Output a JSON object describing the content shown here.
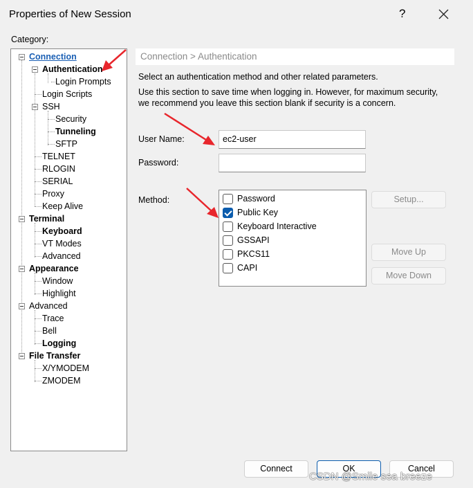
{
  "window": {
    "title": "Properties of New Session",
    "help_label": "?"
  },
  "category_label": "Category:",
  "tree": {
    "connection": "Connection",
    "authentication": "Authentication",
    "login_prompts": "Login Prompts",
    "login_scripts": "Login Scripts",
    "ssh": "SSH",
    "security": "Security",
    "tunneling": "Tunneling",
    "sftp": "SFTP",
    "telnet": "TELNET",
    "rlogin": "RLOGIN",
    "serial": "SERIAL",
    "proxy": "Proxy",
    "keep_alive": "Keep Alive",
    "terminal": "Terminal",
    "keyboard": "Keyboard",
    "vt_modes": "VT Modes",
    "terminal_advanced": "Advanced",
    "appearance": "Appearance",
    "window": "Window",
    "highlight": "Highlight",
    "advanced": "Advanced",
    "trace": "Trace",
    "bell": "Bell",
    "logging": "Logging",
    "file_transfer": "File Transfer",
    "xymodem": "X/YMODEM",
    "zmodem": "ZMODEM"
  },
  "panel": {
    "breadcrumb": "Connection > Authentication",
    "desc1": "Select an authentication method and other related parameters.",
    "desc2_line1": "Use this section to save time when logging in. However, for maximum security,",
    "desc2_line2": "we recommend you leave this section blank if security is a concern.",
    "username_label": "User Name:",
    "username_value": "ec2-user",
    "password_label": "Password:",
    "password_value": "",
    "method_label": "Method:",
    "methods": [
      {
        "label": "Password",
        "checked": false
      },
      {
        "label": "Public Key",
        "checked": true
      },
      {
        "label": "Keyboard Interactive",
        "checked": false
      },
      {
        "label": "GSSAPI",
        "checked": false
      },
      {
        "label": "PKCS11",
        "checked": false
      },
      {
        "label": "CAPI",
        "checked": false
      }
    ],
    "setup_label": "Setup...",
    "move_up_label": "Move Up",
    "move_down_label": "Move Down"
  },
  "footer": {
    "connect_label": "Connect",
    "ok_label": "OK",
    "cancel_label": "Cancel"
  },
  "watermark": "CSDN @Smile sea breeze",
  "colors": {
    "link": "#1a5fb4",
    "check": "#0b5cad",
    "annotation_arrow": "#e8262c"
  }
}
